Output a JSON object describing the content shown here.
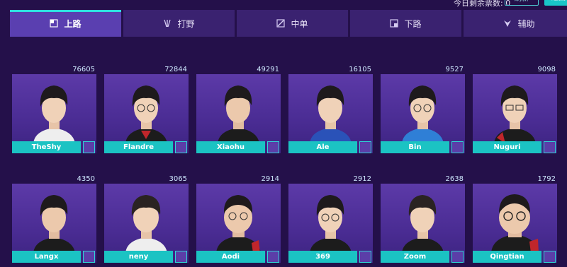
{
  "topbar": {
    "count_text": "今日剩余票数: 0",
    "btn1": "刷新",
    "btn2": "返回"
  },
  "tabs": [
    {
      "label": "上路",
      "icon": "top-lane-icon"
    },
    {
      "label": "打野",
      "icon": "jungle-icon"
    },
    {
      "label": "中单",
      "icon": "mid-lane-icon"
    },
    {
      "label": "下路",
      "icon": "bot-lane-icon"
    },
    {
      "label": "辅助",
      "icon": "support-icon"
    }
  ],
  "players_row1": [
    {
      "name": "TheShy",
      "votes": "76605"
    },
    {
      "name": "Flandre",
      "votes": "72844"
    },
    {
      "name": "Xiaohu",
      "votes": "49291"
    },
    {
      "name": "Ale",
      "votes": "16105"
    },
    {
      "name": "Bin",
      "votes": "9527"
    },
    {
      "name": "Nuguri",
      "votes": "9098"
    }
  ],
  "players_row2": [
    {
      "name": "Langx",
      "votes": "4350"
    },
    {
      "name": "neny",
      "votes": "3065"
    },
    {
      "name": "Aodi",
      "votes": "2914"
    },
    {
      "name": "369",
      "votes": "2912"
    },
    {
      "name": "Zoom",
      "votes": "2638"
    },
    {
      "name": "Qingtian",
      "votes": "1792"
    }
  ],
  "colors": {
    "accent": "#1bc3c3",
    "bg": "#24104a",
    "tab": "#3a2270",
    "tab_active": "#5a3fb0"
  }
}
